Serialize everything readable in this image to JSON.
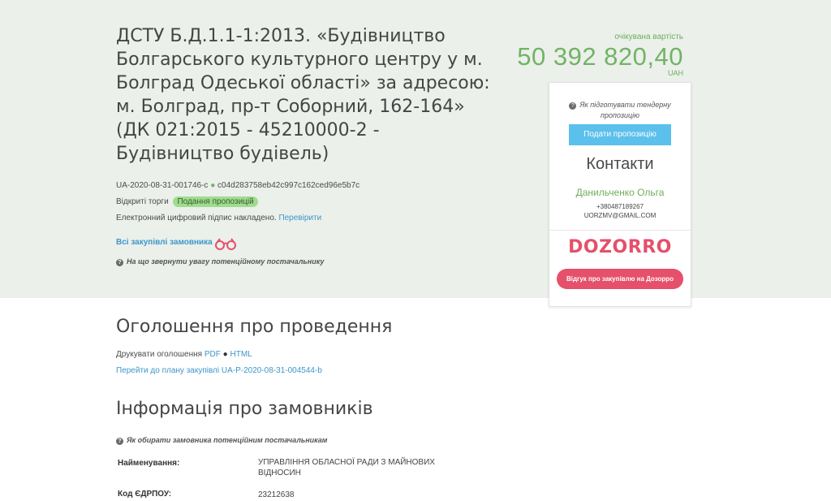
{
  "tender": {
    "title": "ДСТУ Б.Д.1.1-1:2013. «Будівництво Болгарського культурного центру у м. Болград Одеської області» за адресою: м. Болград, пр-т Соборний, 162-164» (ДК 021:2015 - 45210000-2 - Будівництво будівель)",
    "id": "UA-2020-08-31-001746-c",
    "hash": "c04d283758eb42c997c162ced96e5b7c",
    "procedure_type": "Відкриті торги",
    "status": "Подання пропозицій",
    "signature_text": "Електронний цифровий підпис накладено.",
    "verify_link": "Перевірити",
    "all_purchases_link": "Всі закупівлі замовника",
    "attention_hint": "На що звернути увагу потенційному постачальнику"
  },
  "value": {
    "label": "очікувана вартість",
    "amount": "50 392 820,40",
    "currency": "UAH"
  },
  "panel": {
    "prepare_hint": "Як підготувати тендерну пропозицію",
    "submit_button": "Подати пропозицію",
    "contacts_heading": "Контакти",
    "contact_name": "Данильченко Ольга",
    "contact_phone": "+380487189267",
    "contact_email": "UORZMV@GMAIL.COM",
    "logo_text": "DOZORRO",
    "review_button": "Відгук про закупівлю на Дозорро"
  },
  "announcement": {
    "heading": "Оголошення про проведення",
    "print_label": "Друкувати оголошення",
    "pdf_link": "PDF",
    "html_link": "HTML",
    "plan_link": "Перейти до плану закупівлі UA-P-2020-08-31-004544-b"
  },
  "customer": {
    "heading": "Інформація про замовників",
    "hint": "Як обирати замовника потенційним постачальникам",
    "rows": [
      {
        "label": "Найменування:",
        "value": "УПРАВЛІННЯ ОБЛАСНОЇ РАДИ З МАЙНОВИХ ВІДНОСИН"
      },
      {
        "label": "Код ЄДРПОУ:",
        "value": "23212638"
      }
    ]
  },
  "colors": {
    "hero_bg": "#ebf0eb",
    "accent_green": "#72b365",
    "link_blue": "#3d96c9",
    "button_blue": "#5bc0eb",
    "dozorro_red": "#e5506a"
  }
}
